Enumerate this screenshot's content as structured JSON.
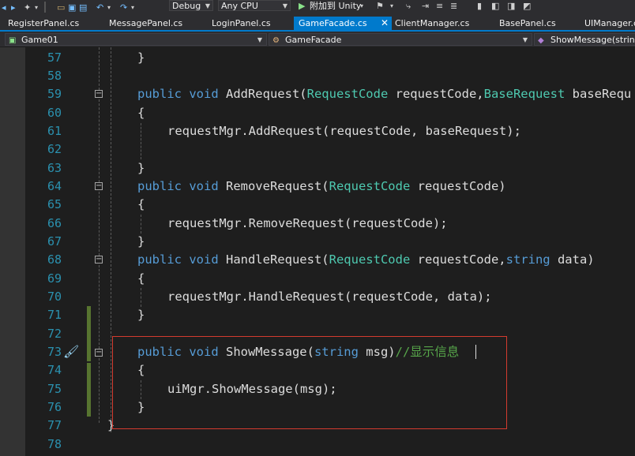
{
  "toolbar": {
    "config": "Debug",
    "platform": "Any CPU",
    "attach_label": "附加到 Unity"
  },
  "tabs": [
    {
      "label": "RegisterPanel.cs"
    },
    {
      "label": "MessagePanel.cs"
    },
    {
      "label": "LoginPanel.cs"
    },
    {
      "label": "GameFacade.cs",
      "active": true
    },
    {
      "label": "ClientManager.cs"
    },
    {
      "label": "BasePanel.cs"
    },
    {
      "label": "UIManager.cs"
    }
  ],
  "nav": {
    "project": "Game01",
    "class": "GameFacade",
    "member": "ShowMessage(string"
  },
  "code": {
    "line_numbers": [
      "57",
      "58",
      "59",
      "60",
      "61",
      "62",
      "63",
      "64",
      "65",
      "66",
      "67",
      "68",
      "69",
      "70",
      "71",
      "72",
      "73",
      "74",
      "75",
      "76",
      "77",
      "78"
    ],
    "l57": "}",
    "l59_kw": "public void ",
    "l59_name": "AddRequest(",
    "l59_t1": "RequestCode",
    "l59_mid": " requestCode,",
    "l59_t2": "BaseRequest",
    "l59_end": " baseRequ",
    "l60": "{",
    "l61": "requestMgr.AddRequest(requestCode, baseRequest);",
    "l63": "}",
    "l64_kw": "public void ",
    "l64_name": "RemoveRequest(",
    "l64_t1": "RequestCode",
    "l64_end": " requestCode)",
    "l65": "{",
    "l66": "requestMgr.RemoveRequest(requestCode);",
    "l67": "}",
    "l68_kw": "public void ",
    "l68_name": "HandleRequest(",
    "l68_t1": "RequestCode",
    "l68_mid": " requestCode,",
    "l68_kw2": "string",
    "l68_end": " data)",
    "l69": "{",
    "l70": "requestMgr.HandleRequest(requestCode, data);",
    "l71": "}",
    "l73_kw": "public void ",
    "l73_name": "ShowMessage(",
    "l73_kw2": "string",
    "l73_end": " msg)",
    "l73_comment": "//显示信息",
    "l74": "{",
    "l75": "uiMgr.ShowMessage(msg);",
    "l76": "}",
    "l77": "}"
  }
}
